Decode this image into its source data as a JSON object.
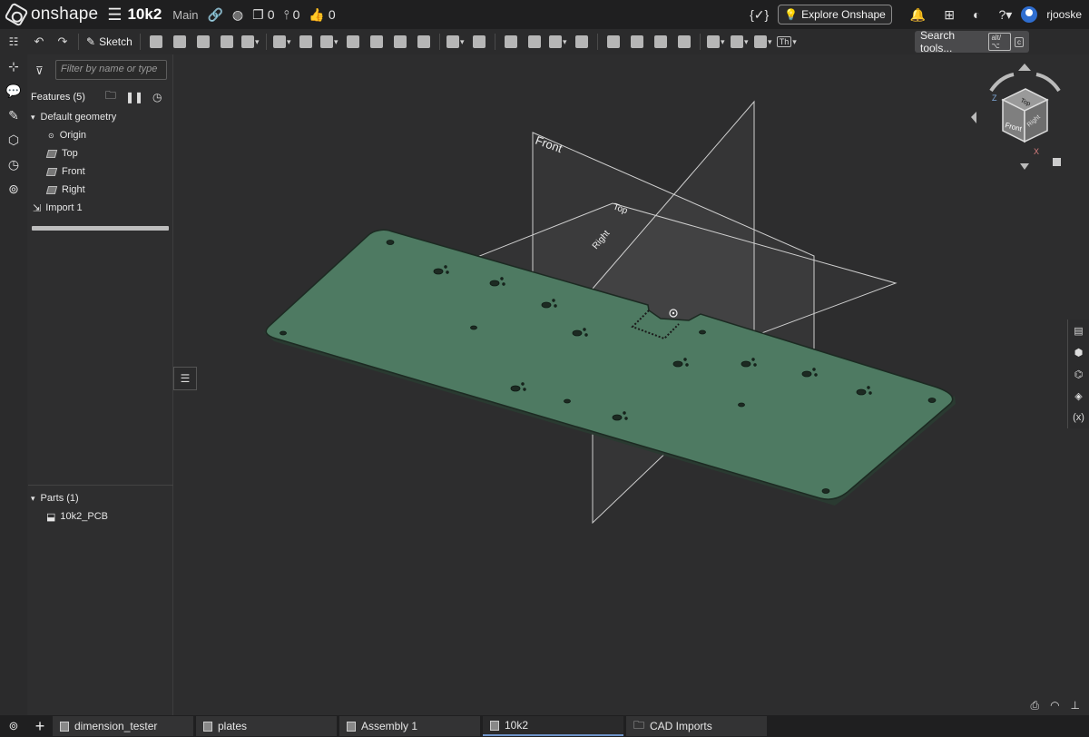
{
  "app": {
    "brand": "onshape",
    "doc_name": "10k2",
    "branch": "Main",
    "count_versions": "0",
    "count_branches": "0",
    "count_likes": "0"
  },
  "topright": {
    "explore_label": "Explore Onshape",
    "user": "rjooske"
  },
  "toolbar": {
    "sketch_label": "Sketch",
    "th_label": "Th",
    "search_label": "Search tools...",
    "search_shortcut": "alt/⌥",
    "search_key": "c"
  },
  "panel": {
    "filter_placeholder": "Filter by name or type",
    "features_title": "Features (5)",
    "default_geometry": "Default geometry",
    "origin": "Origin",
    "plane_top": "Top",
    "plane_front": "Front",
    "plane_right": "Right",
    "import": "Import 1",
    "parts_title": "Parts (1)",
    "part_name": "10k2_PCB"
  },
  "viewport": {
    "plane_front_label": "Front",
    "plane_top_label": "Top",
    "plane_right_label": "Right",
    "cube_top": "Top",
    "cube_front": "Front",
    "cube_right": "Right",
    "axis_z": "Z",
    "axis_x": "X",
    "pcb_color": "#4e7a62"
  },
  "tabs": [
    {
      "label": "dimension_tester"
    },
    {
      "label": "plates"
    },
    {
      "label": "Assembly 1"
    },
    {
      "label": "10k2"
    },
    {
      "label": "CAD Imports"
    }
  ]
}
